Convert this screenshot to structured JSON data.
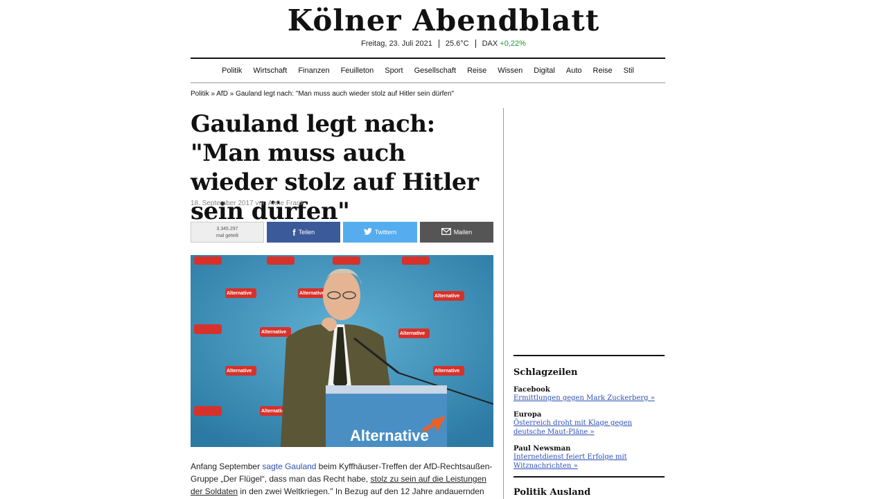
{
  "masthead": {
    "logo": "Kölner Abendblatt"
  },
  "meta": {
    "date": "Freitag, 23. Juli 2021",
    "temp": "25.6°C",
    "dax_label": "DAX",
    "dax_value": "+0,22%",
    "dax_color": "#1a9c2e"
  },
  "nav": [
    "Politik",
    "Wirtschaft",
    "Finanzen",
    "Feuilleton",
    "Sport",
    "Gesellschaft",
    "Reise",
    "Wissen",
    "Digital",
    "Auto",
    "Reise",
    "Stil"
  ],
  "breadcrumb": {
    "l1": "Politik",
    "l2": "AfD",
    "l3": "Gauland legt nach: \"Man muss auch wieder stolz auf Hitler sein dürfen\""
  },
  "article": {
    "headline": "Gauland legt nach: \"Man muss auch wieder stolz auf Hitler sein dürfen\"",
    "byline": "18. September 2017 von Anne Frank",
    "photo_podium_text": "Alternative",
    "photo_backdrop_text": "Alternative",
    "body": {
      "p1": "Anfang September ",
      "link1": "sagte Gauland",
      "p2": " beim Kyffhäuser-Treffen der AfD-Rechtsaußen-Gruppe „Der Flügel“, dass man das Recht habe, ",
      "link2": "stolz zu sein auf die Leistungen der Soldaten",
      "p3": " in den zwei Weltkriegen.\" In Bezug auf den 12 Jahre andauernden"
    }
  },
  "share": {
    "count": "3.345.297",
    "count_label": "mal geteilt",
    "facebook": "Teilen",
    "twitter": "Twittern",
    "mail": "Mailen",
    "colors": {
      "facebook": "#3b5a99",
      "twitter": "#55acee",
      "mail": "#555555"
    }
  },
  "sidebar": {
    "title": "Schlagzeilen",
    "items": [
      {
        "category": "Facebook",
        "link": "Ermittlungen gegen Mark Zuckerberg »"
      },
      {
        "category": "Europa",
        "link": "Österreich droht mit Klage gegen deutsche Maut-Pläne »"
      },
      {
        "category": "Paul Newsman",
        "link": "Internetdienst feiert Erfolge mit Witznachrichten »"
      }
    ],
    "next_title": "Politik Ausland"
  }
}
